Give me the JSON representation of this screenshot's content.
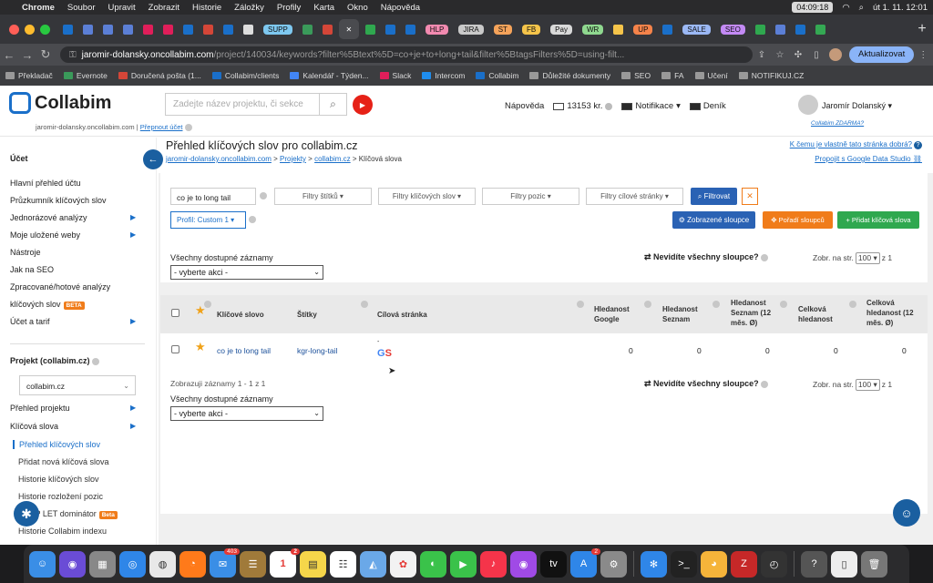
{
  "menubar": {
    "items": [
      "Chrome",
      "Soubor",
      "Upravit",
      "Zobrazit",
      "Historie",
      "Záložky",
      "Profily",
      "Karta",
      "Okno",
      "Nápověda"
    ],
    "time": "04:09:18",
    "datetime": "út 1. 11.  12:01"
  },
  "tabs": {
    "labeled": [
      {
        "label": "SUPP",
        "color": "#7ec8f0"
      },
      {
        "label": "HLP",
        "color": "#f28ab0"
      },
      {
        "label": "JIRA",
        "color": "#c9c9c9"
      },
      {
        "label": "ST",
        "color": "#f5a35a"
      },
      {
        "label": "FB",
        "color": "#f5c44a"
      },
      {
        "label": "Pay",
        "color": "#d9d9d9"
      },
      {
        "label": "WR",
        "color": "#8fd88f"
      },
      {
        "label": "UP",
        "color": "#f5834a"
      },
      {
        "label": "SALE",
        "color": "#9bb8f5"
      },
      {
        "label": "SEO",
        "color": "#c38af5"
      }
    ],
    "close_glyph": "✕",
    "new_tab_glyph": "+"
  },
  "address": {
    "host": "jaromir-dolansky.oncollabim.com",
    "path": "/project/140034/keywords?filter%5Btext%5D=co+je+to+long+tail&filter%5BtagsFilters%5D=using-filt...",
    "update_button": "Aktualizovat"
  },
  "bookmarks": [
    "Překladač",
    "Evernote",
    "Doručená pošta (1...",
    "Collabim/clients",
    "Kalendář - Týden...",
    "Slack",
    "Intercom",
    "Collabim",
    "Důležité dokumenty",
    "SEO",
    "FA",
    "Učení",
    "NOTIFIKUJ.CZ"
  ],
  "header": {
    "logo_text": "Collabim",
    "account_domain": "jaromir-dolansky.oncollabim.com",
    "switch_account": "Přepnout účet",
    "search_placeholder": "Zadejte název projektu, či sekce",
    "help": "Nápověda",
    "credit": "13153 kr.",
    "notifications": "Notifikace",
    "diary": "Deník",
    "user_name": "Jaromír Dolanský",
    "user_sub": "Collabim ZDARMA?"
  },
  "sidebar": {
    "account_heading": "Účet",
    "items": [
      {
        "label": "Hlavní přehled účtu",
        "arrow": false
      },
      {
        "label": "Průzkumník klíčových slov",
        "arrow": false
      },
      {
        "label": "Jednorázové analýzy",
        "arrow": true
      },
      {
        "label": "Moje uložené weby",
        "arrow": true
      },
      {
        "label": "Nástroje",
        "arrow": false
      },
      {
        "label": "Jak na SEO",
        "arrow": false
      },
      {
        "label": "Zpracované/hotové analýzy",
        "arrow": false
      },
      {
        "label": "klíčových slov",
        "arrow": false,
        "beta": "BETA"
      },
      {
        "label": "Účet a tarif",
        "arrow": true
      }
    ],
    "project_heading": "Projekt (collabim.cz)",
    "project_select": "collabim.cz",
    "project_items": [
      {
        "label": "Přehled projektu",
        "arrow": true
      },
      {
        "label": "Klíčová slova",
        "arrow": true
      }
    ],
    "sub_items": [
      "Přehled klíčových slov",
      "Přidat nová klíčová slova",
      "Historie klíčových slov",
      "Historie rozložení pozic",
      "SERP LET dominátor",
      "Historie Collabim indexu"
    ],
    "beta_small": "Beta"
  },
  "page": {
    "title": "Přehled klíčových slov pro collabim.cz",
    "breadcrumb": {
      "root": "jaromir-dolansky.oncollabim.com",
      "projects": "Projekty",
      "project": "collabim.cz",
      "current": "Klíčová slova",
      "sep": ">"
    },
    "link_help": "K čemu je vlastně tato stránka dobrá?",
    "link_gds": "Propojit s Google Data Studio"
  },
  "filters": {
    "text_value": "co je to long tail",
    "tags": "Filtry štítků",
    "keywords": "Filtry klíčových slov",
    "positions": "Filtry pozic",
    "target": "Filtry cílové stránky",
    "submit": "Filtrovat",
    "reset": "✕",
    "profile": "Profil: Custom 1",
    "shown_columns": "Zobrazené sloupce",
    "column_order": "Pořadí sloupců",
    "add_keyword": "Přidat klíčová slova"
  },
  "actions": {
    "label": "Všechny dostupné záznamy",
    "select": "- vyberte akci -",
    "cant_see_columns": "Nevidíte všechny sloupce?",
    "per_page_label": "Zobr. na str.",
    "per_page_value": "100",
    "per_page_of": "z 1",
    "records": "Zobrazuji záznamy 1 - 1 z 1"
  },
  "table": {
    "headers": {
      "keyword": "Klíčové slovo",
      "tags": "Štítky",
      "target": "Cílová stránka",
      "sv_google": "Hledanost Google",
      "sv_seznam": "Hledanost Seznam",
      "sv_seznam12": "Hledanost Seznam (12 měs. Ø)",
      "sv_total": "Celková hledanost",
      "sv_total12": "Celková hledanost (12 měs. Ø)"
    },
    "rows": [
      {
        "keyword": "co je to long tail",
        "tag": "kgr-long-tail",
        "target_gs": "GS",
        "target_dash": "-",
        "sv_google": "0",
        "sv_seznam": "0",
        "sv_seznam12": "0",
        "sv_total": "0",
        "sv_total12": "0"
      }
    ]
  },
  "dock": {
    "mail_badge": "403",
    "calendar_badge": "2",
    "calendar_day": "1",
    "appstore_badge": "2"
  }
}
